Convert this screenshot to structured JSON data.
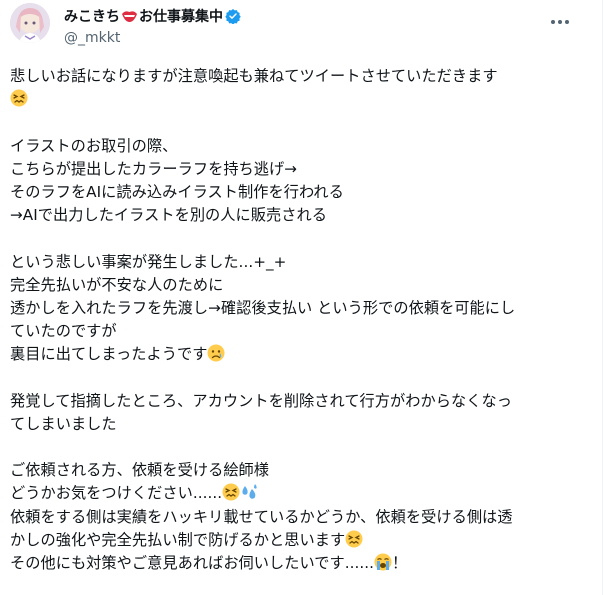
{
  "author": {
    "display_name_part1": "みこきち",
    "display_name_part2": "お仕事募集中",
    "handle": "@_mkkt"
  },
  "icons": {
    "avatar": "avatar-image",
    "mouth_emoji": "lips-emoji-icon",
    "verified": "verified-badge-icon",
    "more": "more-options-icon"
  },
  "colors": {
    "verified_blue": "#1d9bf0",
    "text_primary": "#0f1419",
    "text_secondary": "#536471"
  },
  "tweet": {
    "l1": "悲しいお話になりますが注意喚起も兼ねてツイートさせていただきます",
    "l3": "イラストのお取引の際、",
    "l4": "こちらが提出したカラーラフを持ち逃げ→",
    "l5": "そのラフをAIに読み込みイラスト制作を行われる",
    "l6": "→AIで出力したイラストを別の人に販売される",
    "l8": "という悲しい事案が発生しました...+_+",
    "l9": "完全先払いが不安な人のために",
    "l10": "透かしを入れたラフを先渡し→確認後支払い という形での依頼を可能にし",
    "l11": "ていたのですが",
    "l12": "裏目に出てしまったようです",
    "l14": "発覚して指摘したところ、アカウントを削除されて行方がわからなくなっ",
    "l15": "てしまいました",
    "l17": "ご依頼される方、依頼を受ける絵師様",
    "l18": "どうかお気をつけください......",
    "l19": "依頼をする側は実績をハッキリ載せているかどうか、依頼を受ける側は透",
    "l20": "かしの強化や完全先払い制で防げるかと思います",
    "l21": "その他にも対策やご意見あればお伺いしたいです......",
    "l21_end": "！"
  },
  "emoji": {
    "confounded": "confounded-face-icon",
    "sad": "sad-tear-face-icon",
    "sweat": "sweat-droplets-icon",
    "crying": "loudly-crying-face-icon"
  }
}
